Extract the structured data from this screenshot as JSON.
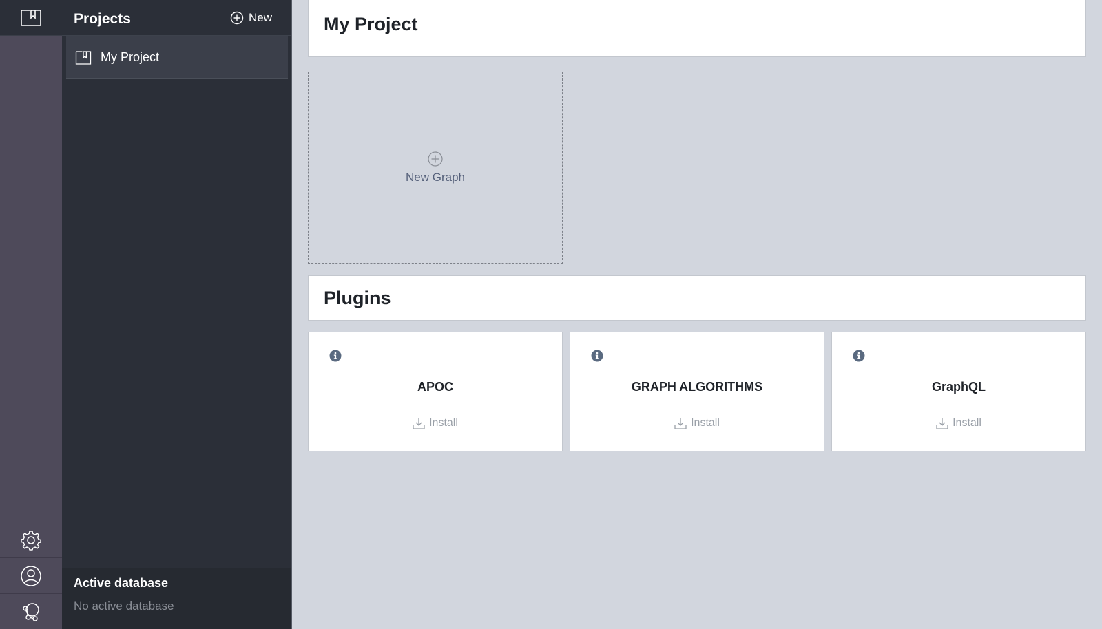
{
  "sidebar": {
    "title": "Projects",
    "new_label": "New",
    "projects": [
      {
        "label": "My Project"
      }
    ],
    "active_db": {
      "title": "Active database",
      "value": "No active database"
    }
  },
  "main": {
    "project_title": "My Project",
    "new_graph_label": "New Graph",
    "plugins_title": "Plugins",
    "plugins": [
      {
        "name": "APOC",
        "install_label": "Install"
      },
      {
        "name": "GRAPH ALGORITHMS",
        "install_label": "Install"
      },
      {
        "name": "GraphQL",
        "install_label": "Install"
      }
    ]
  },
  "icons": {
    "rail_top": "projects-book-icon",
    "rail_bottom": [
      "settings-gear-icon",
      "user-profile-icon",
      "community-icon"
    ],
    "info": "info-icon",
    "install": "download-icon"
  },
  "colors": {
    "rail": "#4e4a5a",
    "sidebar": "#2b2f38",
    "main_bg": "#d2d6de",
    "accent_text": "#55607a",
    "info_icon": "#5a6a80"
  }
}
